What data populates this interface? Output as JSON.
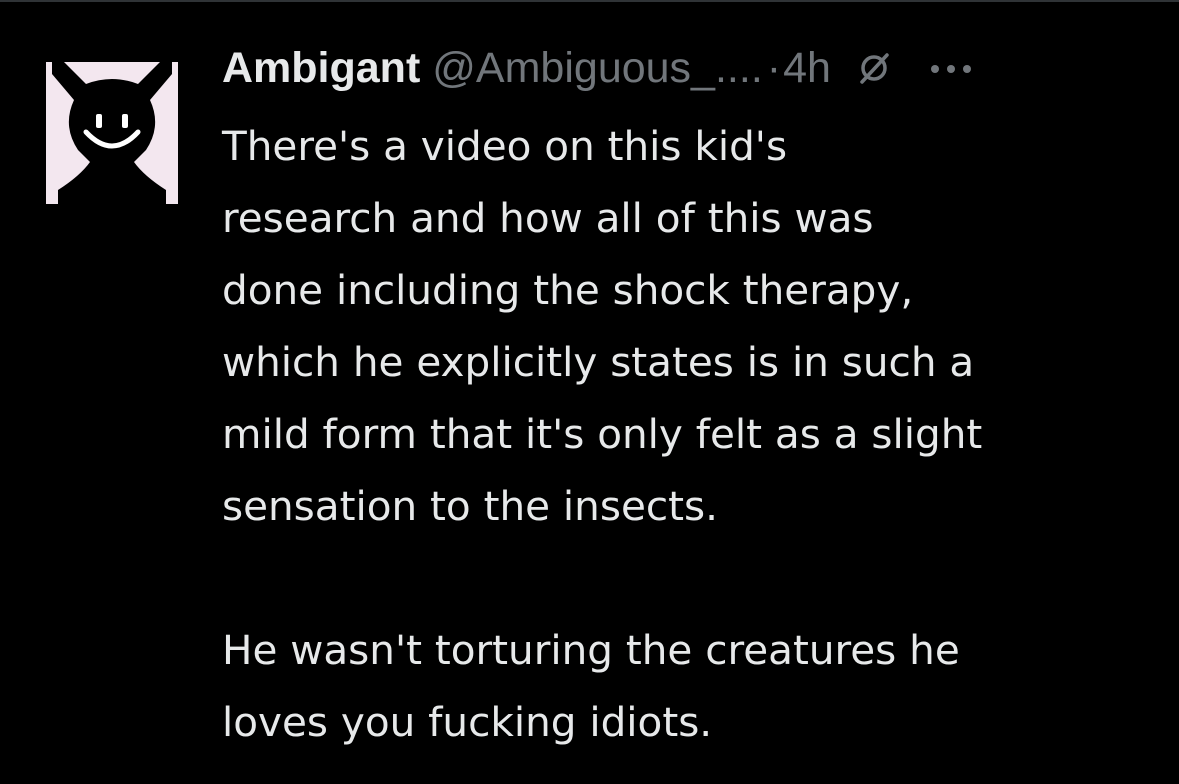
{
  "tweet": {
    "author": {
      "display_name": "Ambigant",
      "handle": "@Ambiguous_....",
      "avatar_icon": "smiling-horned-figure-avatar"
    },
    "separator": "·",
    "time_ago": "4h",
    "muted_icon": "muted-circle-slash-icon",
    "more_icon": "more-options-icon",
    "body": {
      "paragraph_1": "There's a video on this kid's\nresearch and how all of this was\ndone including the shock therapy,\nwhich he explicitly states is in such a\nmild form that it's only felt as a slight\nsensation to the insects.",
      "paragraph_2": "He wasn't torturing the creatures he\nloves you fucking idiots."
    }
  },
  "colors": {
    "background": "#000000",
    "primary_text": "#e7e9ea",
    "secondary_text": "#71767b",
    "avatar_bg": "#f3e7ef"
  }
}
